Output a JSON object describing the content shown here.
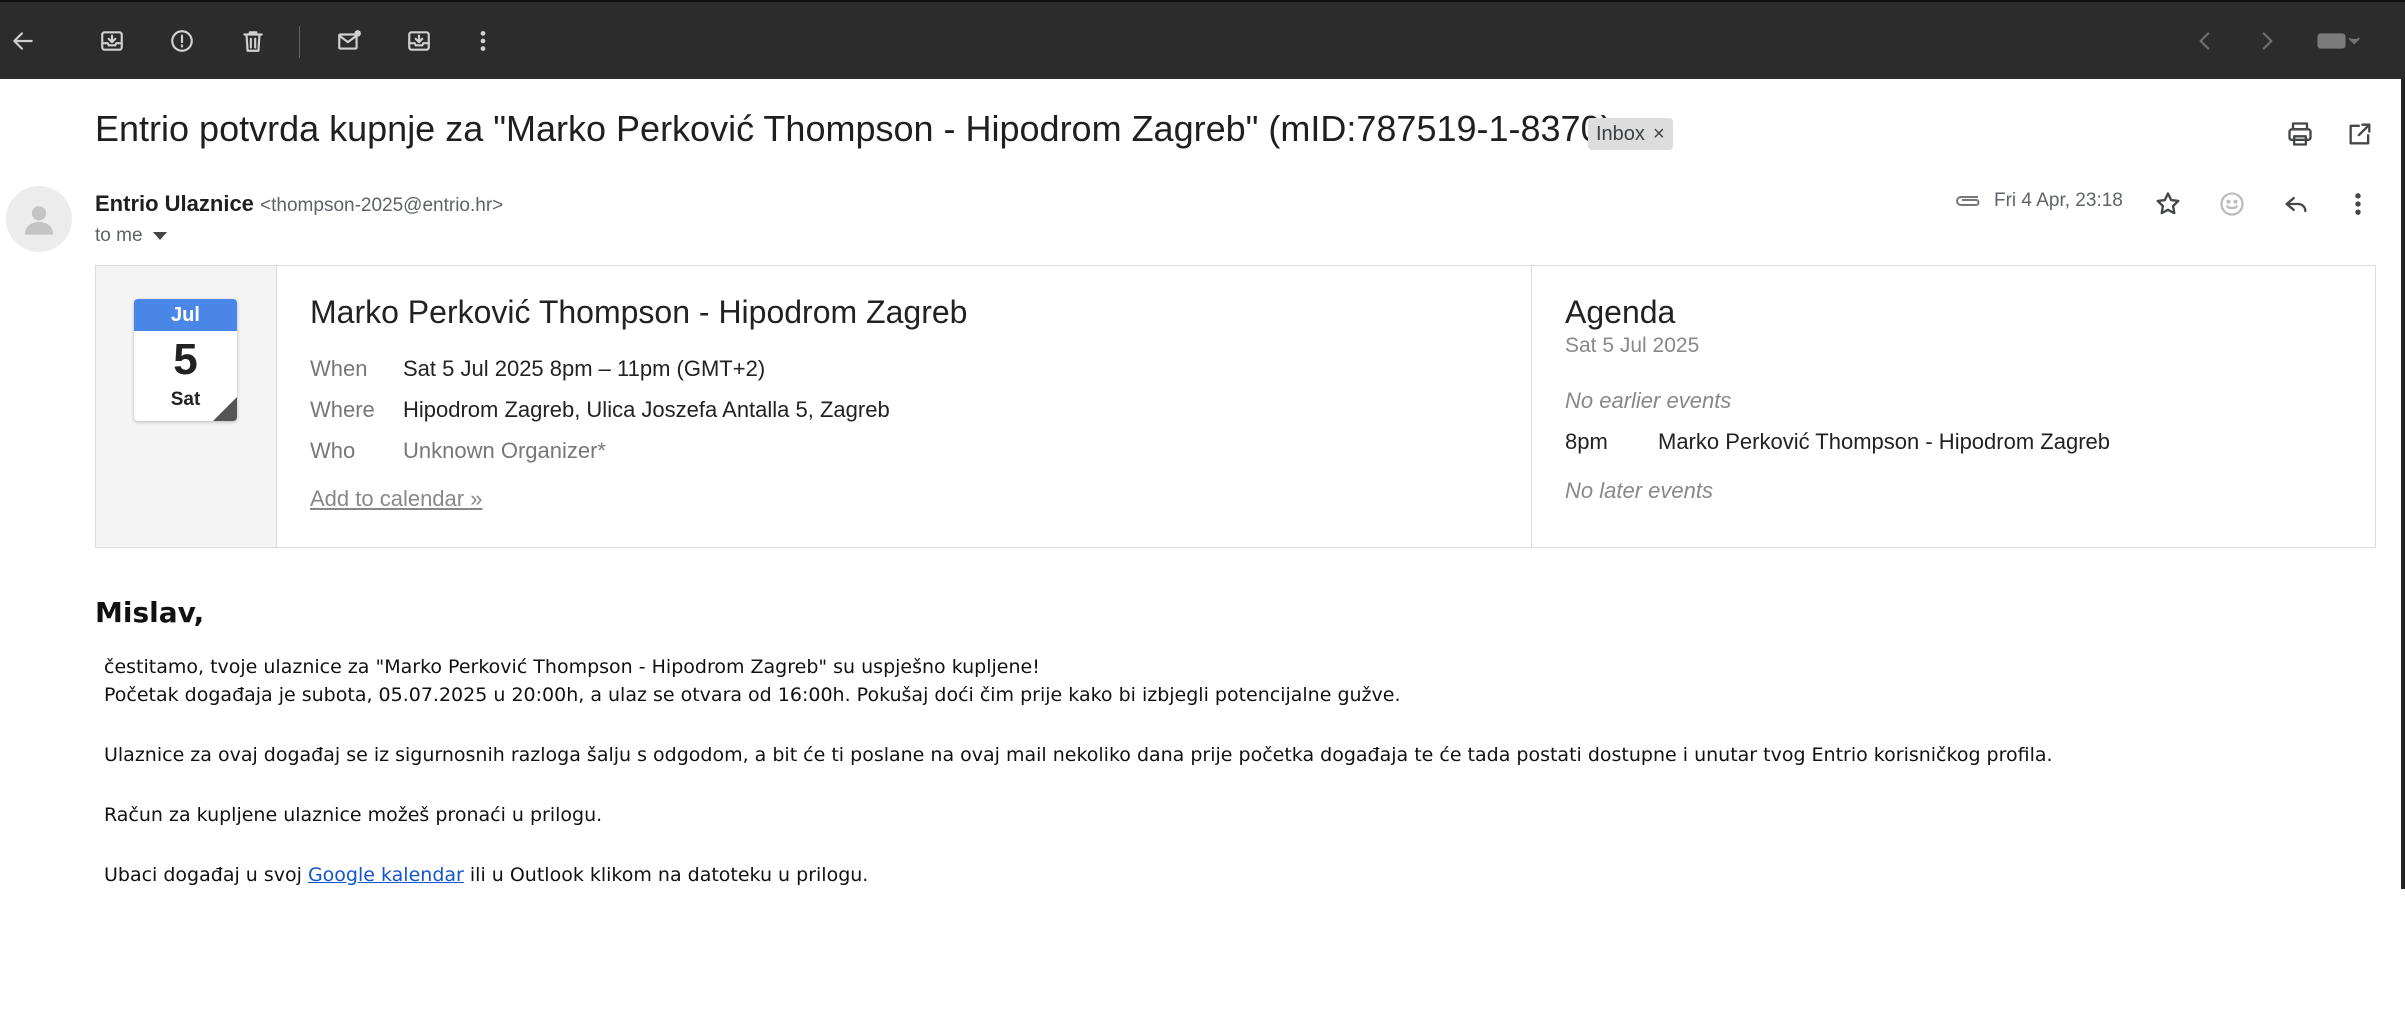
{
  "toolbar": {
    "icons": [
      "back-arrow-icon",
      "archive-icon",
      "report-spam-icon",
      "delete-icon",
      "mark-unread-icon",
      "move-to-icon",
      "more-vertical-icon",
      "prev-icon",
      "next-icon",
      "keyboard-icon"
    ]
  },
  "email": {
    "subject": "Entrio potvrda kupnje za \"Marko Perković Thompson - Hipodrom Zagreb\" (mID:787519-1-8370)",
    "label_chip": "Inbox",
    "label_close": "×",
    "sender_name": "Entrio Ulaznice",
    "sender_email": "<thompson-2025@entrio.hr>",
    "recipient": "to me",
    "date": "Fri 4 Apr, 23:18"
  },
  "calendar_card": {
    "icon_month": "Jul",
    "icon_day": "5",
    "icon_weekday": "Sat",
    "event_title": "Marko Perković Thompson - Hipodrom Zagreb",
    "when_label": "When",
    "when_value": "Sat 5 Jul 2025 8pm – 11pm (GMT+2)",
    "where_label": "Where",
    "where_value": "Hipodrom Zagreb, Ulica Joszefa Antalla 5, Zagreb",
    "who_label": "Who",
    "who_value": "Unknown Organizer*",
    "add_link": "Add to calendar »"
  },
  "agenda": {
    "title": "Agenda",
    "date": "Sat 5 Jul 2025",
    "no_earlier": "No earlier events",
    "event_time": "8pm",
    "event_title": "Marko Perković Thompson - Hipodrom Zagreb",
    "no_later": "No later events"
  },
  "body": {
    "greeting": "Mislav,",
    "line1": "čestitamo, tvoje ulaznice za \"Marko Perković Thompson - Hipodrom Zagreb\" su uspješno kupljene!",
    "line2": "Početak događaja je subota, 05.07.2025 u 20:00h, a ulaz se otvara od 16:00h. Pokušaj doći čim prije kako bi izbjegli potencijalne gužve.",
    "line3": "Ulaznice za ovaj događaj se iz sigurnosnih razloga šalju s odgodom, a bit će ti poslane na ovaj mail nekoliko dana prije početka događaja te će tada postati dostupne i unutar tvog Entrio korisničkog profila.",
    "line4": "Račun za kupljene ulaznice možeš pronaći u prilogu.",
    "line5_before": "Ubaci događaj u svoj ",
    "line5_link": "Google kalendar",
    "line5_after": " ili u Outlook klikom na datoteku u prilogu."
  }
}
